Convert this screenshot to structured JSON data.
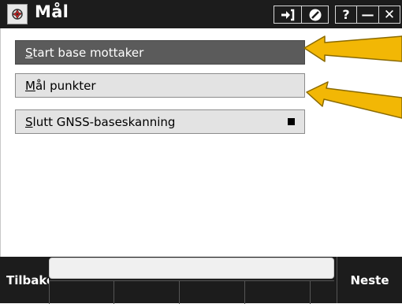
{
  "window": {
    "title": "Mål",
    "icons": {
      "app": "rose-icon",
      "login": "login-arrow-icon",
      "cancel": "no-entry-icon",
      "help": "?",
      "minimize": "—",
      "close": "✕"
    }
  },
  "menu": {
    "items": [
      {
        "hotkey": "S",
        "rest": "tart base mottaker",
        "state": "selected"
      },
      {
        "hotkey": "M",
        "rest": "ål punkter",
        "state": "normal"
      },
      {
        "hotkey": "S",
        "rest": "lutt GNSS-baseskanning",
        "state": "normal",
        "icon": "stop-square-icon"
      }
    ]
  },
  "annotations": {
    "arrow_color": "#f2b705"
  },
  "bottom": {
    "back_label": "Tilbake",
    "next_label": "Neste"
  }
}
